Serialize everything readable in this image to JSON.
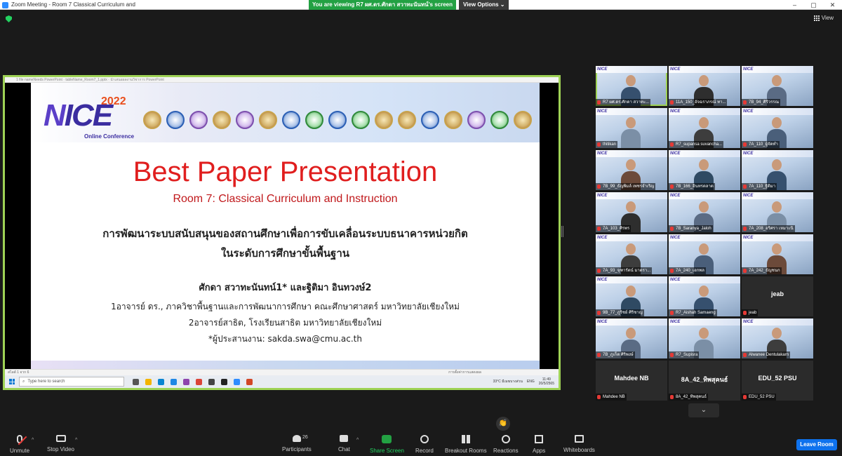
{
  "window": {
    "title": "Zoom Meeting - Room 7 Classical Curriculum and",
    "min": "–",
    "max": "▢",
    "close": "✕"
  },
  "share_banner": {
    "text": "You are viewing R7 ผศ.ดร.ศักดา สวาทะนันทน์'s screen",
    "view_options": "View Options ⌄"
  },
  "view_button": {
    "label": "View"
  },
  "presentation": {
    "ppt_title": "1 file nameNeeds PowerPoint · tableName_Room7_1.pptx · นำเสนอผลงานวิชาการ PowerPoint",
    "logo_text": "ICE",
    "logo_year": "2022",
    "logo_subtitle": "Online Conference",
    "title": "Best Paper Presentation",
    "room": "Room 7: Classical Curriculum and Instruction",
    "thai_title_line1": "การพัฒนาระบบสนับสนุนของสถานศึกษาเพื่อการขับเคลื่อนระบบธนาคารหน่วยกิต",
    "thai_title_line2": "ในระดับการศึกษาขั้นพื้นฐาน",
    "authors": "ศักดา สวาทะนันทน์1* และฐิติมา อินทวงษ์2",
    "affiliation1": "1อาจารย์ ดร., ภาควิชาพื้นฐานและการพัฒนาการศึกษา คณะศึกษาศาสตร์ มหาวิทยาลัยเชียงใหม่",
    "affiliation2": "2อาจารย์สาธิต, โรงเรียนสาธิต มหาวิทยาลัยเชียงใหม่",
    "correspondence": "*ผู้ประสานงาน: sakda.swa@cmu.ac.th",
    "status_left": "สไลด์ 1 จาก 6",
    "status_right": "การตั้งค่าการแสดงผล"
  },
  "taskbar": {
    "search_placeholder": "Type here to search",
    "weather": "33°C มีเมฆบางส่วน",
    "lang": "ENG",
    "time": "11:49",
    "date": "20/5/2565"
  },
  "participants": [
    {
      "name": "R7 ผศ.ดร.ศักดา สวาทะ...",
      "video": true,
      "active": true
    },
    {
      "name": "11A_150_อัจฉราภรณ์ ทา...",
      "video": true
    },
    {
      "name": "7B_94_ศิริวรรณ",
      "video": true
    },
    {
      "name": "thitikan",
      "video": true
    },
    {
      "name": "R7_supansa suvancha...",
      "video": true
    },
    {
      "name": "7A_110_ผู้จัดทำ",
      "video": true
    },
    {
      "name": "7B_99_ธัญพิมล์ เพชรจำเริญ",
      "video": true
    },
    {
      "name": "7B_166_อินทรตลาด",
      "video": true
    },
    {
      "name": "7A_110_ฐิติมา",
      "video": true
    },
    {
      "name": "7A_103_ศิรพร",
      "video": true
    },
    {
      "name": "7B_Saranya_Jaloh",
      "video": true
    },
    {
      "name": "7A_208_อริศรา เหมาะนิ",
      "video": true
    },
    {
      "name": "7A_93_จุฑารัตน์ มาตรา...",
      "video": true
    },
    {
      "name": "7A_240_เอกพล",
      "video": true
    },
    {
      "name": "7A_242_ธัญชนก",
      "video": true
    },
    {
      "name": "9B_77_ภูริชย์ ศิริชาญ",
      "video": true
    },
    {
      "name": "R7_Aishah Samaeng",
      "video": true
    },
    {
      "name": "jeab",
      "video": false,
      "display": "jeab"
    },
    {
      "name": "7B_ภูเก็ต ศิริพงษ์",
      "video": true
    },
    {
      "name": "R7_Supisra",
      "video": true
    },
    {
      "name": "Alwanee Dentulakarn",
      "video": true
    },
    {
      "name": "Mahdee NB",
      "video": false,
      "display": "Mahdee NB"
    },
    {
      "name": "8A_42_ทิพสุคนธ์",
      "video": false,
      "display": "8A_42_ทิพสุคนธ์"
    },
    {
      "name": "EDU_52 PSU",
      "video": false,
      "display": "EDU_52 PSU"
    }
  ],
  "toolbar": {
    "unmute": "Unmute",
    "stop_video": "Stop Video",
    "participants": "Participants",
    "participants_count": "26",
    "chat": "Chat",
    "share_screen": "Share Screen",
    "record": "Record",
    "breakout_rooms": "Breakout Rooms",
    "reactions": "Reactions",
    "apps": "Apps",
    "whiteboards": "Whiteboards",
    "leave": "Leave Room"
  },
  "colors": {
    "accent_green": "#9ed255",
    "share_green": "#23a143",
    "leave_blue": "#0e72ed",
    "title_red": "#e01e1e"
  }
}
